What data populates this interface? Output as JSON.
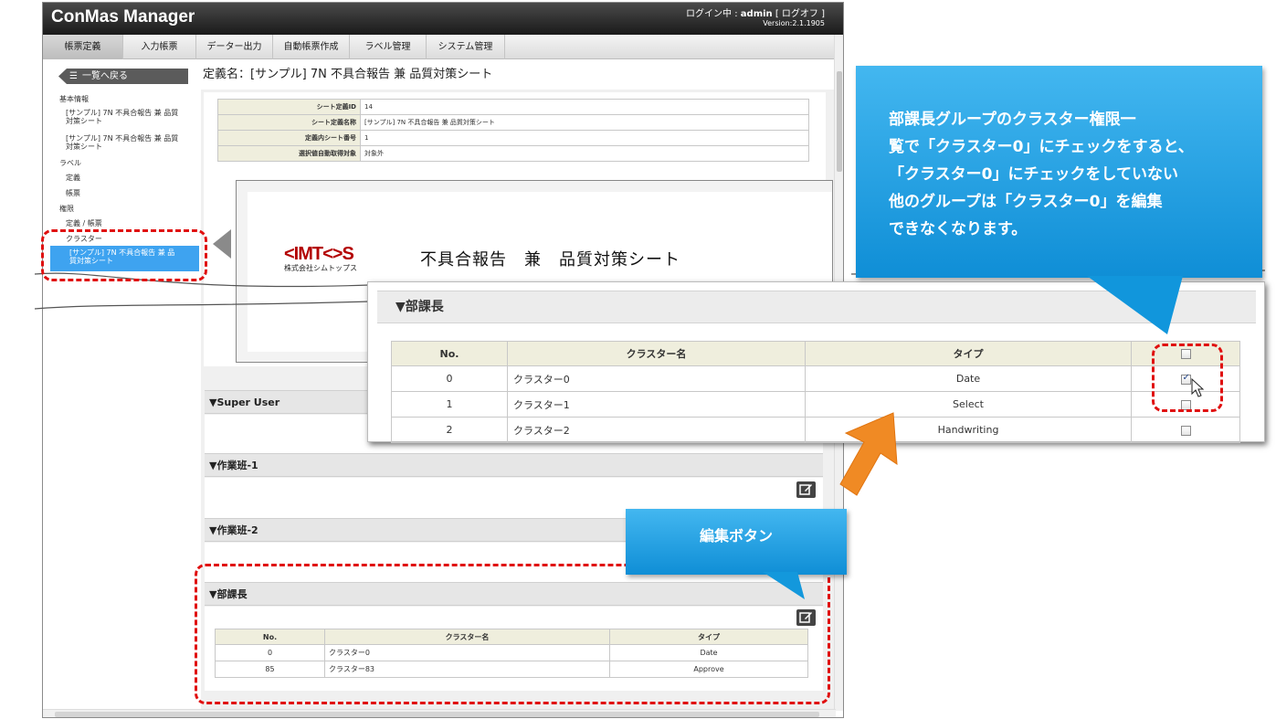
{
  "app": {
    "title": "ConMas Manager",
    "login_prefix": "ログイン中 : ",
    "login_user": "admin",
    "logoff": " [ ログオフ ]",
    "version": "Version:2.1.1905"
  },
  "menu": [
    "帳票定義",
    "入力帳票",
    "データー出力",
    "自動帳票作成",
    "ラベル管理",
    "システム管理"
  ],
  "sidebar": {
    "back_label": "一覧へ戻る",
    "items": [
      "基本情報",
      "[サンプル] 7N 不具合報告 兼 品質",
      "対策シート",
      "[サンプル] 7N 不具合報告 兼 品質",
      "対策シート",
      "ラベル",
      "定義",
      "帳票",
      "権限",
      "定義 / 帳票",
      "クラスター"
    ],
    "selected_line1": "[サンプル] 7N 不具合報告 兼 品",
    "selected_line2": "質対策シート"
  },
  "definition": {
    "title": "定義名：[サンプル] 7N 不具合報告 兼 品質対策シート",
    "rows": [
      {
        "key": "シート定義ID",
        "value": "14"
      },
      {
        "key": "シート定義名称",
        "value": "[サンプル] 7N 不具合報告 兼 品質対策シート"
      },
      {
        "key": "定義内シート番号",
        "value": "1"
      },
      {
        "key": "選択値自動取得対象",
        "value": "対象外"
      }
    ]
  },
  "preview": {
    "logo": "<IMT<>S",
    "company": "株式会社シムトップス",
    "doc_title": "不具合報告　兼　品質対策シート"
  },
  "sections": {
    "super_user": "▼Super User",
    "group1": "▼作業班-1",
    "group2": "▼作業班-2",
    "manager": "▼部課長"
  },
  "manager_table": {
    "headers": [
      "No.",
      "クラスター名",
      "タイプ"
    ],
    "rows": [
      {
        "no": "0",
        "name": "クラスター0",
        "type": "Date"
      },
      {
        "no": "85",
        "name": "クラスター83",
        "type": "Approve"
      }
    ]
  },
  "popup": {
    "title": "▼部課長",
    "headers": [
      "No.",
      "クラスター名",
      "タイプ"
    ],
    "rows": [
      {
        "no": "0",
        "name": "クラスター0",
        "type": "Date"
      },
      {
        "no": "1",
        "name": "クラスター1",
        "type": "Select"
      },
      {
        "no": "2",
        "name": "クラスター2",
        "type": "Handwriting"
      }
    ]
  },
  "callouts": {
    "main_lines": [
      "部課長グループのクラスター権限一",
      "覧で「クラスター0」にチェックをすると、",
      "「クラスター0」にチェックをしていない",
      "他のグループは「クラスター0」を編集",
      "できなくなります。"
    ],
    "edit_button": "編集ボタン"
  },
  "colors": {
    "accent": "#3ea3f0",
    "callout": "#1ba0e2",
    "dash": "#e01010",
    "arrow": "#f08a24"
  }
}
